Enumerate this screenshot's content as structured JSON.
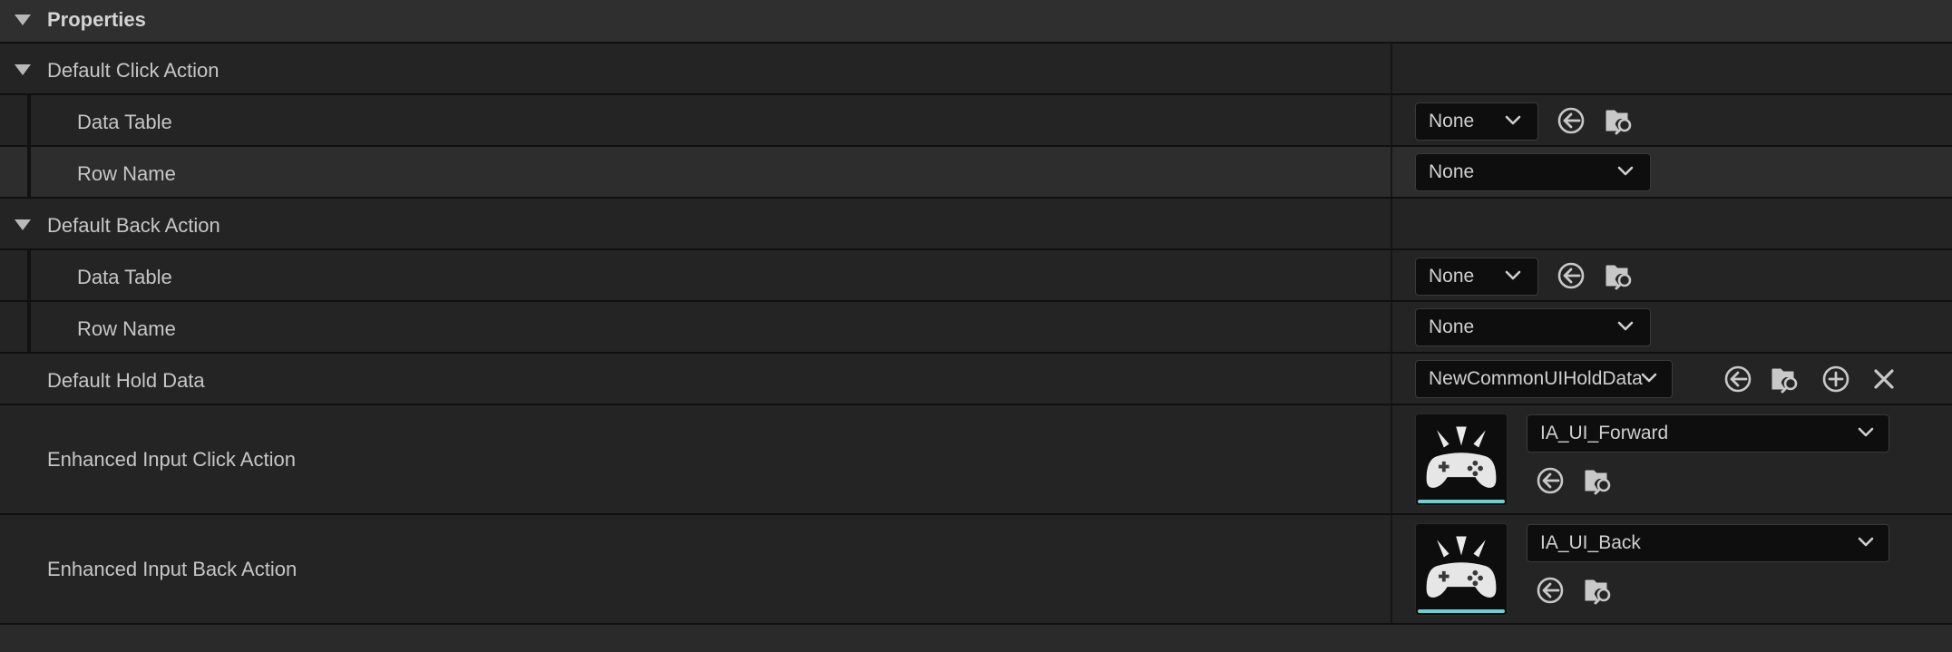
{
  "section": {
    "title": "Properties"
  },
  "click_action": {
    "label": "Default Click Action",
    "data_table": {
      "label": "Data Table",
      "value": "None"
    },
    "row_name": {
      "label": "Row Name",
      "value": "None"
    }
  },
  "back_action": {
    "label": "Default Back Action",
    "data_table": {
      "label": "Data Table",
      "value": "None"
    },
    "row_name": {
      "label": "Row Name",
      "value": "None"
    }
  },
  "hold_data": {
    "label": "Default Hold Data",
    "value": "NewCommonUIHoldData"
  },
  "enhanced_click": {
    "label": "Enhanced Input Click Action",
    "value": "IA_UI_Forward"
  },
  "enhanced_back": {
    "label": "Enhanced Input Back Action",
    "value": "IA_UI_Back"
  },
  "icons": {
    "browse": "use-selected-arrow-icon",
    "find": "browse-folder-icon",
    "add": "add-icon",
    "clear": "clear-icon",
    "asset": "gamepad-input-action-icon",
    "expand": "expand-triangle-icon",
    "dropdown": "chevron-down-icon"
  },
  "colors": {
    "accent": "#6ad0d6",
    "panel": "#2f2f2f",
    "row": "#242424",
    "row_alt": "#2d2d2d"
  }
}
